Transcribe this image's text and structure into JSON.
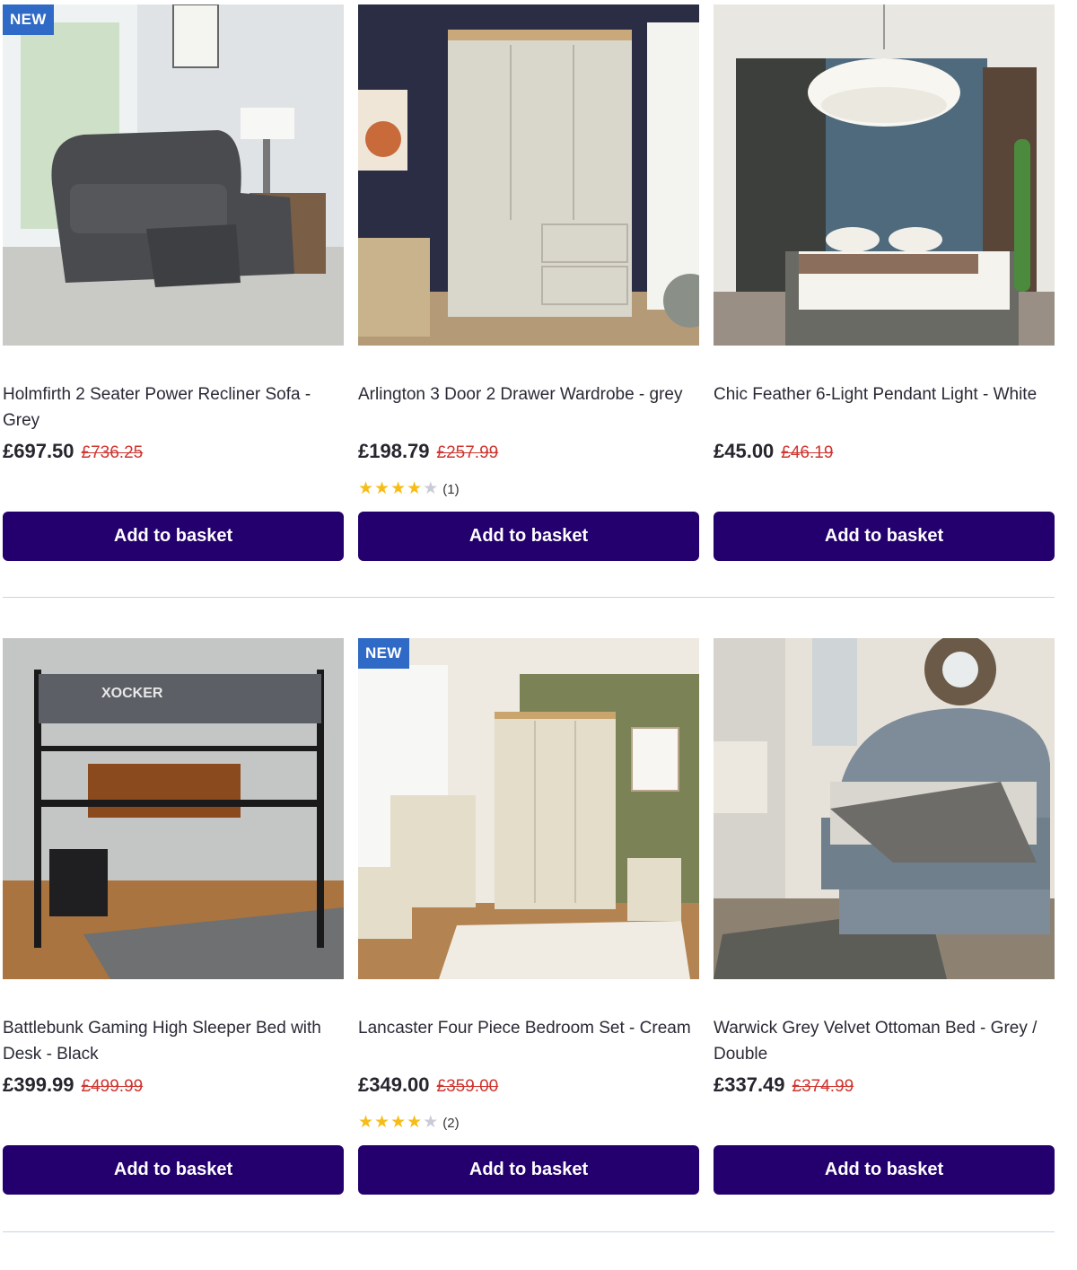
{
  "products": [
    {
      "badge": "NEW",
      "image": "grey-power-recliner-sofa",
      "title": "Holmfirth 2 Seater Power Recliner Sofa - Grey",
      "price": "£697.50",
      "was_price": "£736.25",
      "rating": null,
      "review_count": "",
      "cta": "Add to basket"
    },
    {
      "badge": "",
      "image": "grey-wardrobe",
      "title": "Arlington 3 Door 2 Drawer Wardrobe - grey",
      "price": "£198.79",
      "was_price": "£257.99",
      "rating": 4,
      "review_count": "(1)",
      "cta": "Add to basket"
    },
    {
      "badge": "",
      "image": "feather-pendant-light-bedroom",
      "title": "Chic Feather 6-Light Pendant Light - White",
      "price": "£45.00",
      "was_price": "£46.19",
      "rating": null,
      "review_count": "",
      "cta": "Add to basket"
    },
    {
      "badge": "",
      "image": "gaming-high-sleeper-bed",
      "title": "Battlebunk Gaming High Sleeper Bed with Desk - Black",
      "price": "£399.99",
      "was_price": "£499.99",
      "rating": null,
      "review_count": "",
      "cta": "Add to basket",
      "image_text": "XOCKER"
    },
    {
      "badge": "NEW",
      "image": "cream-bedroom-set",
      "title": "Lancaster Four Piece Bedroom Set - Cream",
      "price": "£349.00",
      "was_price": "£359.00",
      "rating": 4,
      "review_count": "(2)",
      "cta": "Add to basket"
    },
    {
      "badge": "",
      "image": "grey-velvet-ottoman-bed",
      "title": "Warwick Grey Velvet Ottoman Bed - Grey / Double",
      "price": "£337.49",
      "was_price": "£374.99",
      "rating": null,
      "review_count": "",
      "cta": "Add to basket"
    }
  ],
  "colors": {
    "button": "#23006e",
    "badge": "#2f6ac6",
    "was_price": "#d0352f",
    "star": "#f6bd18",
    "divider": "#c8d6de"
  }
}
